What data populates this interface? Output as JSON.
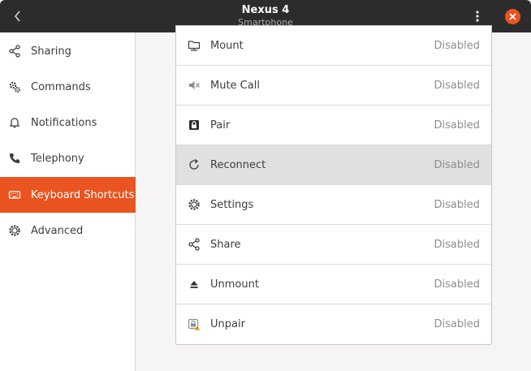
{
  "header": {
    "title": "Nexus 4",
    "subtitle": "Smartphone"
  },
  "sidebar": {
    "items": [
      {
        "label": "Sharing",
        "icon": "share-icon"
      },
      {
        "label": "Commands",
        "icon": "gears-icon"
      },
      {
        "label": "Notifications",
        "icon": "bell-icon"
      },
      {
        "label": "Telephony",
        "icon": "phone-icon"
      },
      {
        "label": "Keyboard Shortcuts",
        "icon": "keyboard-icon",
        "active": true
      },
      {
        "label": "Advanced",
        "icon": "gear-icon"
      }
    ]
  },
  "shortcuts": {
    "rows": [
      {
        "action": "Mount",
        "value": "Disabled",
        "icon": "folder-mount-icon"
      },
      {
        "action": "Mute Call",
        "value": "Disabled",
        "icon": "speaker-muted-icon"
      },
      {
        "action": "Pair",
        "value": "Disabled",
        "icon": "lock-icon"
      },
      {
        "action": "Reconnect",
        "value": "Disabled",
        "icon": "refresh-icon",
        "hover": true
      },
      {
        "action": "Settings",
        "value": "Disabled",
        "icon": "gear-icon"
      },
      {
        "action": "Share",
        "value": "Disabled",
        "icon": "share-icon"
      },
      {
        "action": "Unmount",
        "value": "Disabled",
        "icon": "eject-icon"
      },
      {
        "action": "Unpair",
        "value": "Disabled",
        "icon": "lock-warning-icon"
      }
    ]
  },
  "colors": {
    "accent": "#e95420",
    "headerbar": "#2c2c2c",
    "hover_row": "#e0e0e0"
  }
}
